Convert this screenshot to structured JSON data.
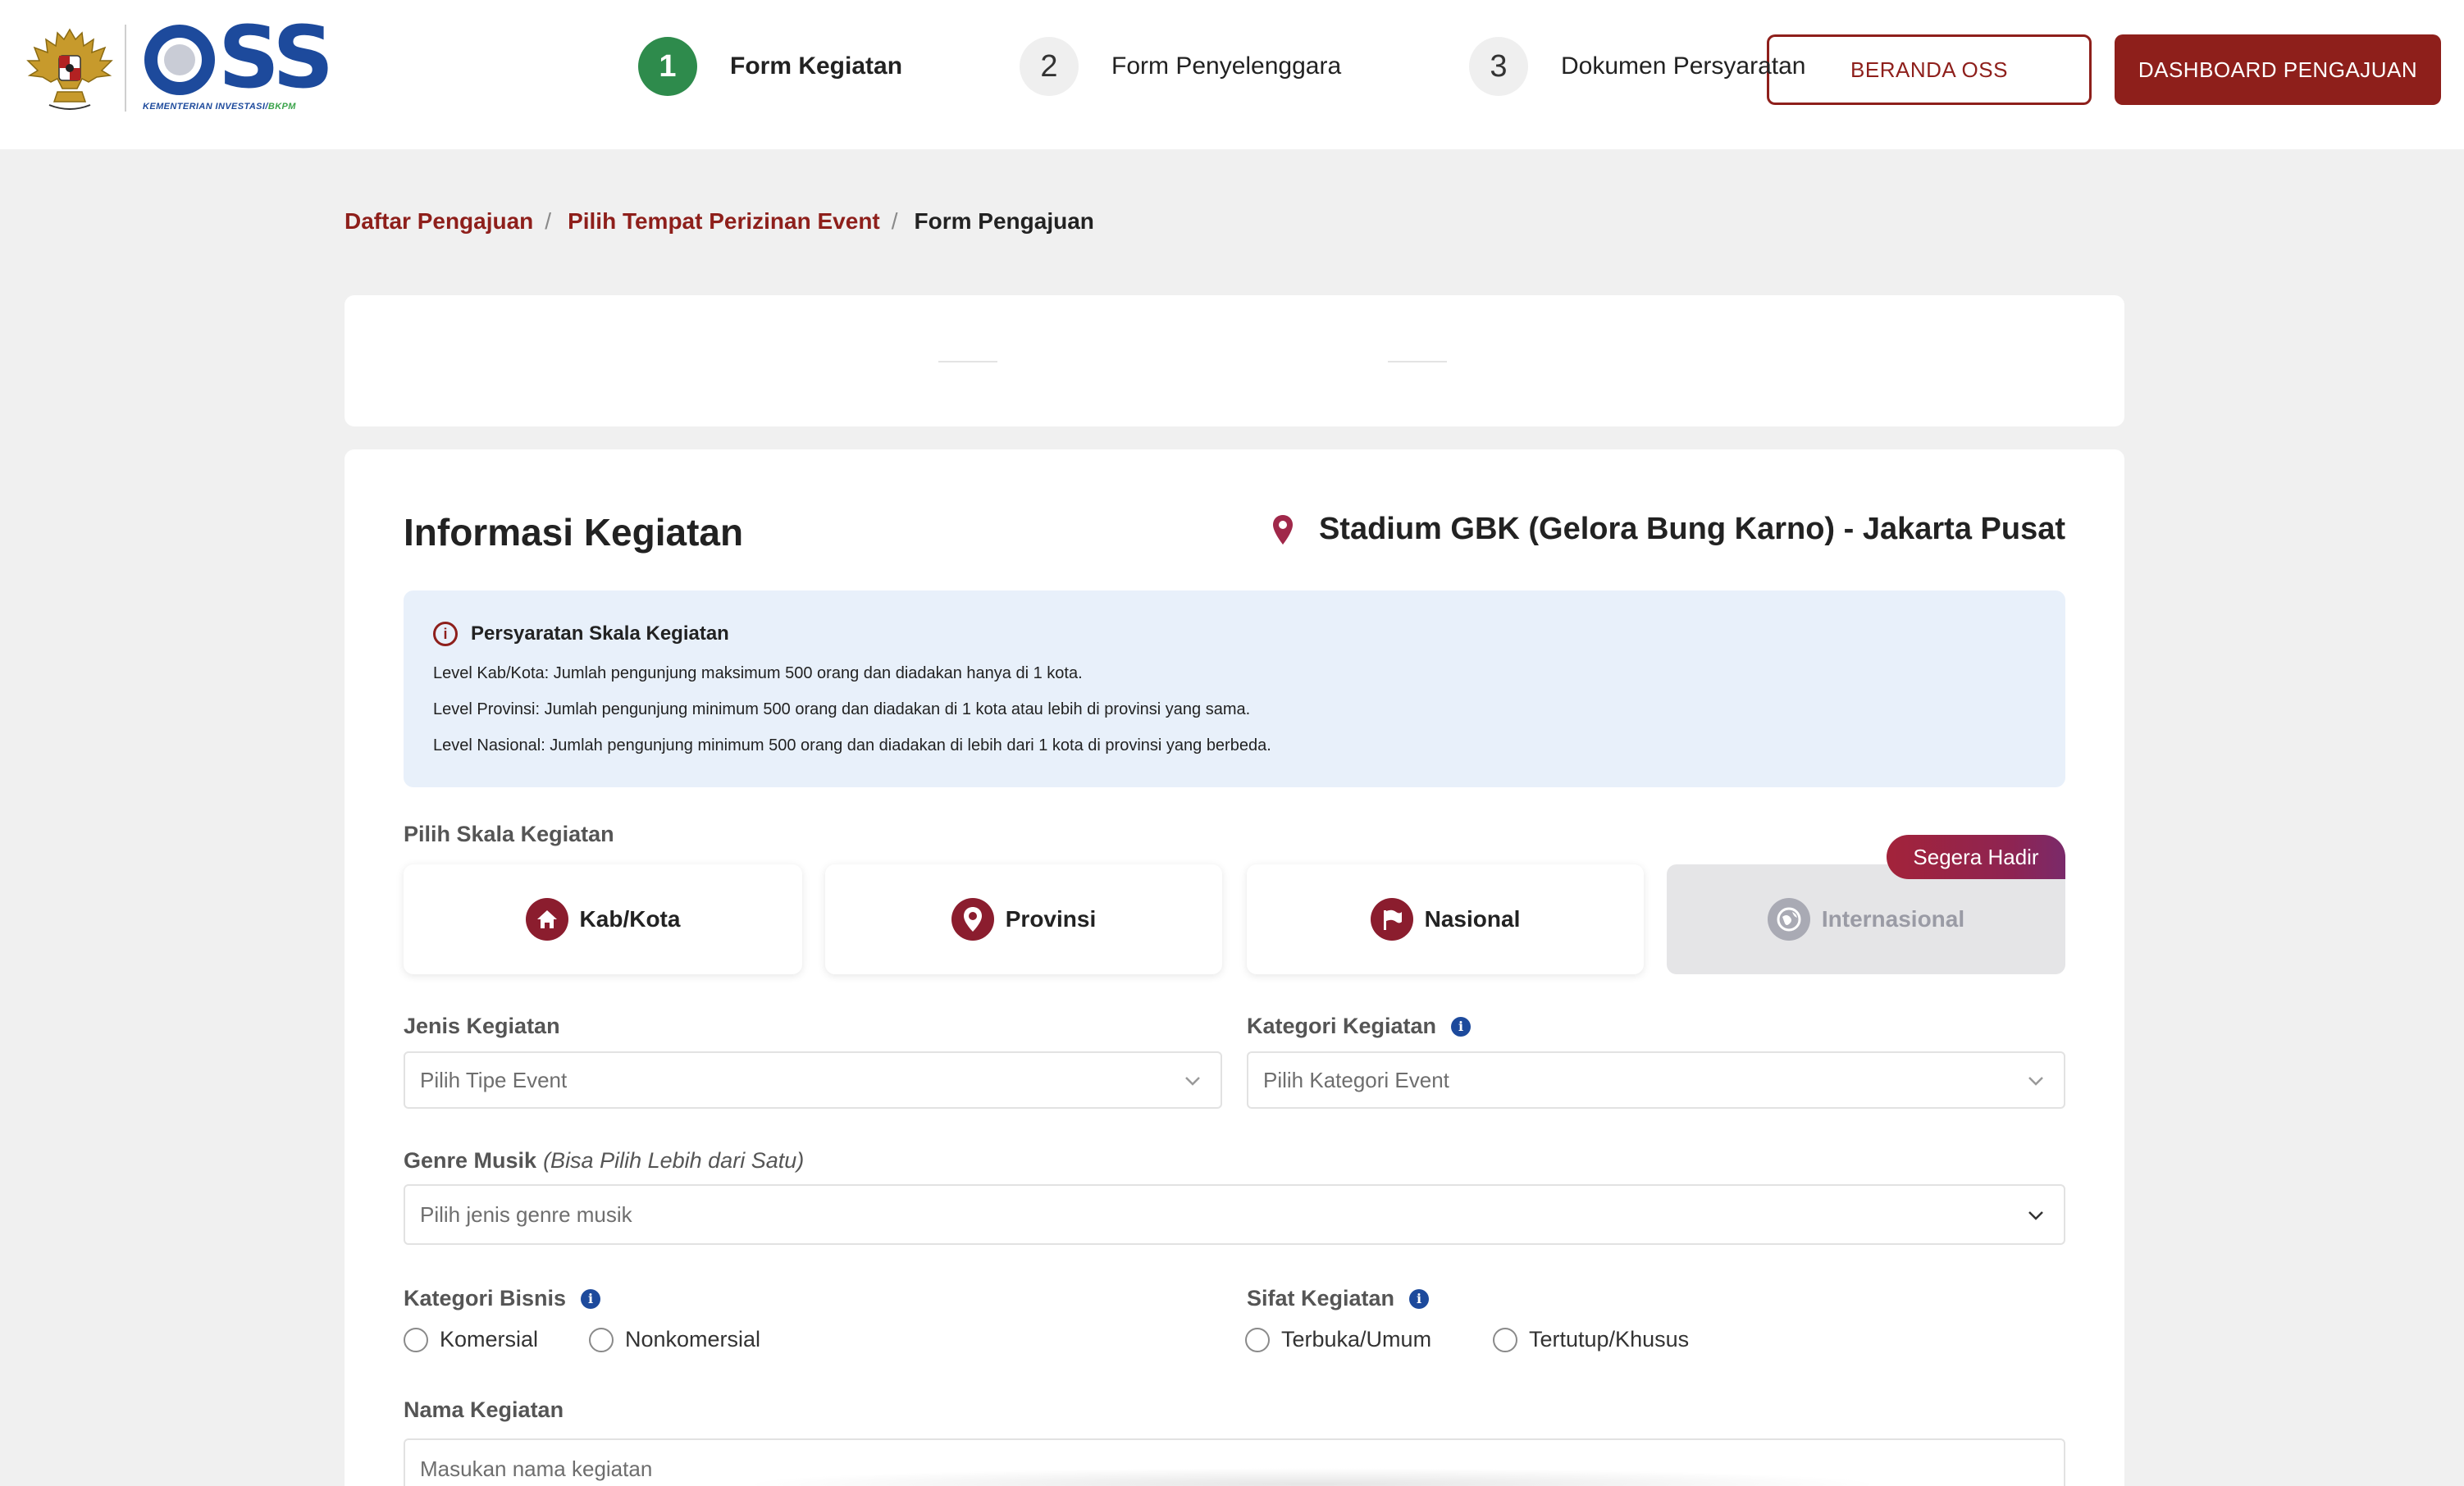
{
  "header": {
    "logo_text": "OSS",
    "logo_subtitle_a": "KEMENTERIAN INVESTASI/",
    "logo_subtitle_b": "BKPM",
    "btn_home": "BERANDA OSS",
    "btn_dashboard": "DASHBOARD PENGAJUAN",
    "brand_color": "#8e1f1b",
    "logo_color": "#1d4a9c"
  },
  "breadcrumb": {
    "items": [
      "Daftar Pengajuan",
      "Pilih Tempat Perizinan Event",
      "Form Pengajuan"
    ],
    "separator": "/"
  },
  "stepper": {
    "steps": [
      {
        "number": "1",
        "label": "Form Kegiatan",
        "active": true
      },
      {
        "number": "2",
        "label": "Form Penyelenggara",
        "active": false
      },
      {
        "number": "3",
        "label": "Dokumen Persyaratan",
        "active": false
      }
    ],
    "active_color": "#2e8b4c"
  },
  "form": {
    "title": "Informasi Kegiatan",
    "venue": "Stadium GBK (Gelora Bung Karno) - Jakarta Pusat",
    "info": {
      "title": "Persyaratan Skala Kegiatan",
      "lines": [
        "Level Kab/Kota: Jumlah pengunjung maksimum 500 orang dan diadakan hanya di 1 kota.",
        "Level Provinsi: Jumlah pengunjung minimum 500 orang dan diadakan di 1 kota atau lebih di provinsi yang sama.",
        "Level Nasional: Jumlah pengunjung minimum 500 orang dan diadakan di lebih dari 1 kota di provinsi yang berbeda."
      ]
    },
    "scale": {
      "label": "Pilih Skala Kegiatan",
      "badge": "Segera Hadir",
      "options": [
        "Kab/Kota",
        "Provinsi",
        "Nasional",
        "Internasional"
      ]
    },
    "jenis": {
      "label": "Jenis Kegiatan",
      "placeholder": "Pilih Tipe Event"
    },
    "kategori": {
      "label": "Kategori Kegiatan",
      "placeholder": "Pilih Kategori Event"
    },
    "genre": {
      "label": "Genre Musik",
      "hint": "(Bisa Pilih Lebih dari Satu)",
      "placeholder": "Pilih jenis genre musik"
    },
    "bisnis": {
      "label": "Kategori Bisnis",
      "options": [
        "Komersial",
        "Nonkomersial"
      ]
    },
    "sifat": {
      "label": "Sifat Kegiatan",
      "options": [
        "Terbuka/Umum",
        "Tertutup/Khusus"
      ]
    },
    "nama": {
      "label": "Nama Kegiatan",
      "placeholder": "Masukan nama kegiatan"
    }
  }
}
